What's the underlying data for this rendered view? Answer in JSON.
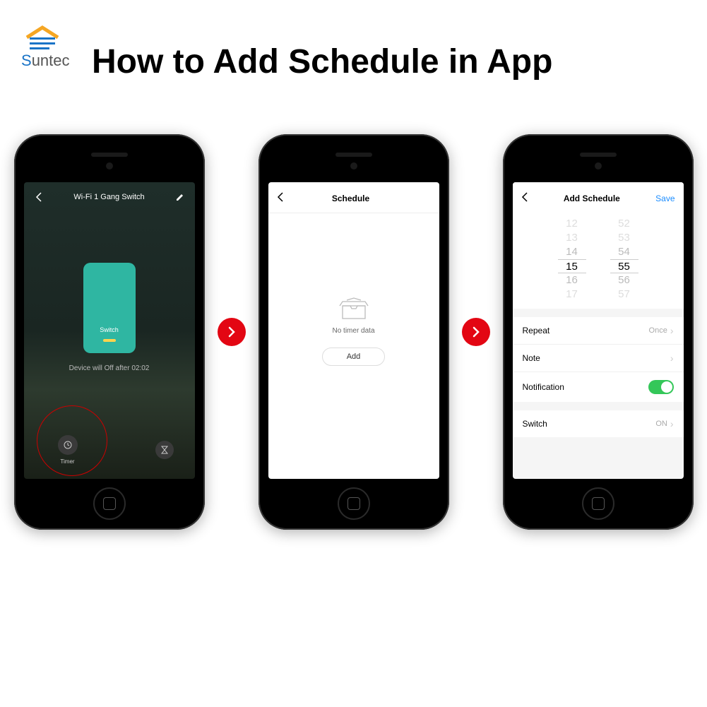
{
  "logo": {
    "brand_s": "S",
    "brand_rest": "untec"
  },
  "title": "How to Add Schedule in App",
  "screen1": {
    "header_title": "Wi-Fi 1 Gang Switch",
    "switch_label": "Switch",
    "device_msg": "Device will Off after 02:02",
    "timer_label": "Timer"
  },
  "screen2": {
    "header_title": "Schedule",
    "empty_text": "No timer data",
    "add_label": "Add"
  },
  "screen3": {
    "header_title": "Add Schedule",
    "save_label": "Save",
    "picker_hours": [
      "12",
      "13",
      "14",
      "15",
      "16",
      "17"
    ],
    "picker_mins": [
      "52",
      "53",
      "54",
      "55",
      "56",
      "57"
    ],
    "rows": {
      "repeat_label": "Repeat",
      "repeat_value": "Once",
      "note_label": "Note",
      "notification_label": "Notification",
      "switch_label": "Switch",
      "switch_value": "ON"
    }
  }
}
